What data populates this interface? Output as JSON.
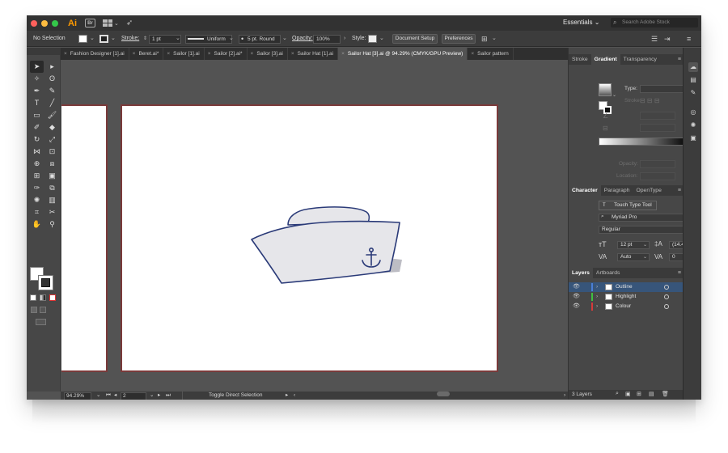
{
  "app": {
    "logo": "Ai",
    "bridge_label": "Br",
    "workspace": "Essentials",
    "stock_search_placeholder": "Search Adobe Stock",
    "traffic_colors": [
      "#fc605c",
      "#fdbc40",
      "#34c84a"
    ]
  },
  "control_bar": {
    "selection": "No Selection",
    "stroke_label": "Stroke:",
    "stroke_weight": "1 pt",
    "profile": "Uniform",
    "brush": "5 pt. Round",
    "opacity_label": "Opacity:",
    "opacity_value": "100%",
    "style_label": "Style:",
    "document_setup": "Document Setup",
    "preferences": "Preferences"
  },
  "tabs": [
    {
      "label": "Fashion Designer [1].ai",
      "active": false
    },
    {
      "label": "Beret.ai*",
      "active": false
    },
    {
      "label": "Sailor [1].ai",
      "active": false
    },
    {
      "label": "Sailor [2].ai*",
      "active": false
    },
    {
      "label": "Sailor [3].ai",
      "active": false
    },
    {
      "label": "Sailor Hat [1].ai",
      "active": false
    },
    {
      "label": "Sailor Hat [3].ai @ 94.29% (CMYK/GPU Preview)",
      "active": true
    },
    {
      "label": "Sailor pattern",
      "active": false
    }
  ],
  "status_bar": {
    "zoom": "94.29%",
    "artboard_number": "2",
    "tool_hint": "Toggle Direct Selection"
  },
  "gradient_panel": {
    "tabs": [
      "Stroke",
      "Gradient",
      "Transparency"
    ],
    "active_tab": "Gradient",
    "type_label": "Type:",
    "stroke_label": "Stroke:",
    "opacity_label": "Opacity:",
    "location_label": "Location:"
  },
  "character_panel": {
    "tabs": [
      "Character",
      "Paragraph",
      "OpenType"
    ],
    "active_tab": "Character",
    "touch_type_tool": "Touch Type Tool",
    "font_family": "Myriad Pro",
    "font_style": "Regular",
    "font_size": "12 pt",
    "leading": "(14.4 pt)",
    "kerning": "Auto",
    "tracking": "0"
  },
  "layers_panel": {
    "tabs": [
      "Layers",
      "Artboards"
    ],
    "active_tab": "Layers",
    "layers": [
      {
        "name": "Outline",
        "color": "#4a7fd6",
        "selected": true
      },
      {
        "name": "Highlight",
        "color": "#3fbf3f",
        "selected": false
      },
      {
        "name": "Colour",
        "color": "#d63a3a",
        "selected": false
      }
    ],
    "count": "3 Layers"
  },
  "artwork": {
    "hat_fill": "#e6e6ea",
    "hat_shadow": "#bdbdc4",
    "outline_color": "#2a3a78",
    "artboard_border": "#7a3a3a"
  }
}
